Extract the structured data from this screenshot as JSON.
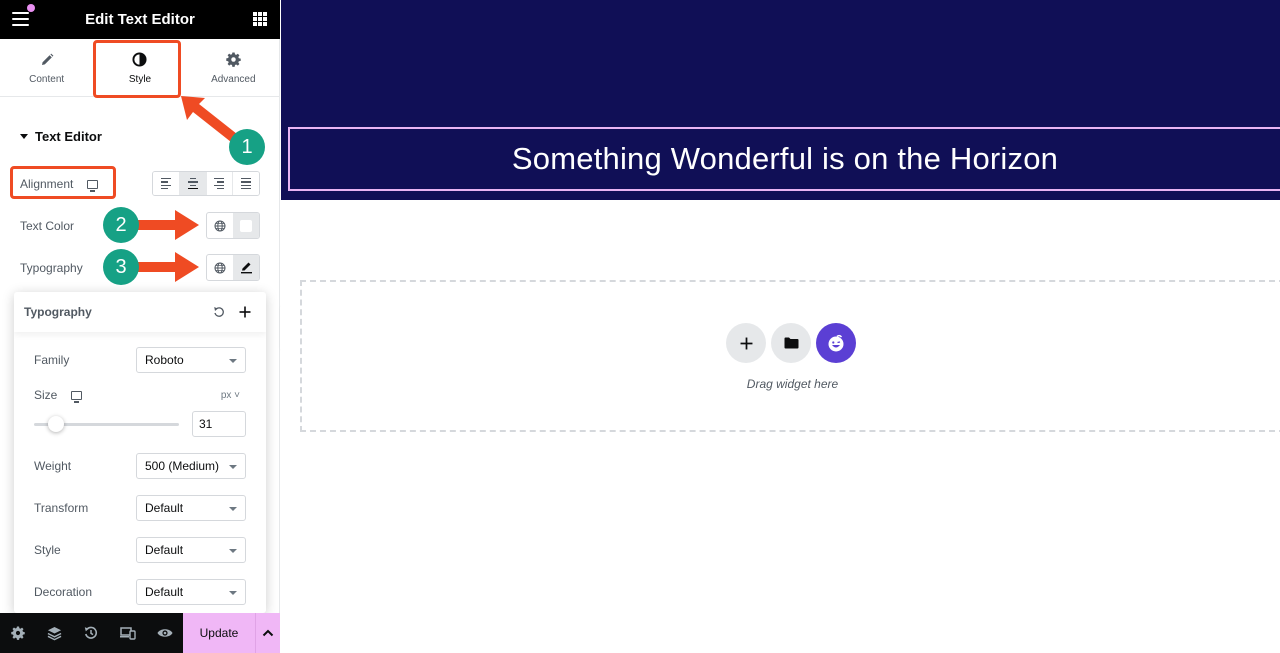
{
  "panel": {
    "title": "Edit Text Editor",
    "tabs": [
      {
        "label": "Content",
        "icon": "pencil-icon"
      },
      {
        "label": "Style",
        "icon": "half-circle-icon",
        "active": true
      },
      {
        "label": "Advanced",
        "icon": "gear-icon"
      }
    ],
    "section_title": "Text Editor",
    "controls": {
      "alignment_label": "Alignment",
      "alignment_options": [
        "left",
        "center",
        "right",
        "justify"
      ],
      "alignment_selected": "center",
      "text_color_label": "Text Color",
      "typography_label": "Typography"
    }
  },
  "typography_popover": {
    "title": "Typography",
    "family_label": "Family",
    "family_value": "Roboto",
    "size_label": "Size",
    "size_unit": "px",
    "size_value": "31",
    "size_slider_fraction": 0.15,
    "weight_label": "Weight",
    "weight_value": "500 (Medium)",
    "transform_label": "Transform",
    "transform_value": "Default",
    "style_label": "Style",
    "style_value": "Default",
    "decoration_label": "Decoration",
    "decoration_value": "Default"
  },
  "footer": {
    "icons": [
      "settings-icon",
      "layers-icon",
      "history-icon",
      "responsive-icon",
      "preview-icon"
    ],
    "update_label": "Update"
  },
  "annotations": {
    "badges": [
      "1",
      "2",
      "3"
    ],
    "color": "#ef4b23",
    "badge_color": "#16a185"
  },
  "canvas": {
    "heading": "Something Wonderful is on the Horizon",
    "hero_color": "#100f56",
    "dropzone_text": "Drag widget here"
  }
}
